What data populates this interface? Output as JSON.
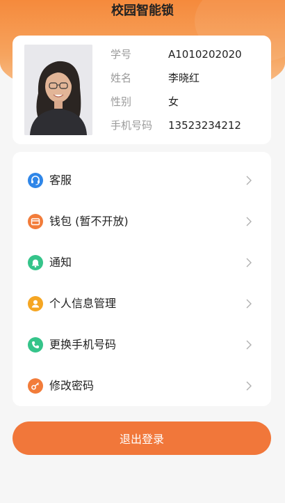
{
  "header": {
    "title": "校园智能锁"
  },
  "profile": {
    "rows": [
      {
        "label": "学号",
        "value": "A1010202020"
      },
      {
        "label": "姓名",
        "value": "李晓红"
      },
      {
        "label": "性别",
        "value": "女"
      },
      {
        "label": "手机号码",
        "value": "13523234212"
      }
    ]
  },
  "menu": {
    "items": [
      {
        "label": "客服",
        "icon": "headset-icon",
        "color": "#2f86e8"
      },
      {
        "label": "钱包 (暂不开放)",
        "icon": "wallet-icon",
        "color": "#f27c3a"
      },
      {
        "label": "通知",
        "icon": "bell-icon",
        "color": "#35c48a"
      },
      {
        "label": "个人信息管理",
        "icon": "user-icon",
        "color": "#f5a623"
      },
      {
        "label": "更换手机号码",
        "icon": "phone-icon",
        "color": "#35c48a"
      },
      {
        "label": "修改密码",
        "icon": "key-icon",
        "color": "#f27c3a"
      }
    ]
  },
  "logout": {
    "label": "退出登录"
  },
  "colors": {
    "accent": "#f1773a",
    "header_gradient_top": "#f58a3c"
  }
}
